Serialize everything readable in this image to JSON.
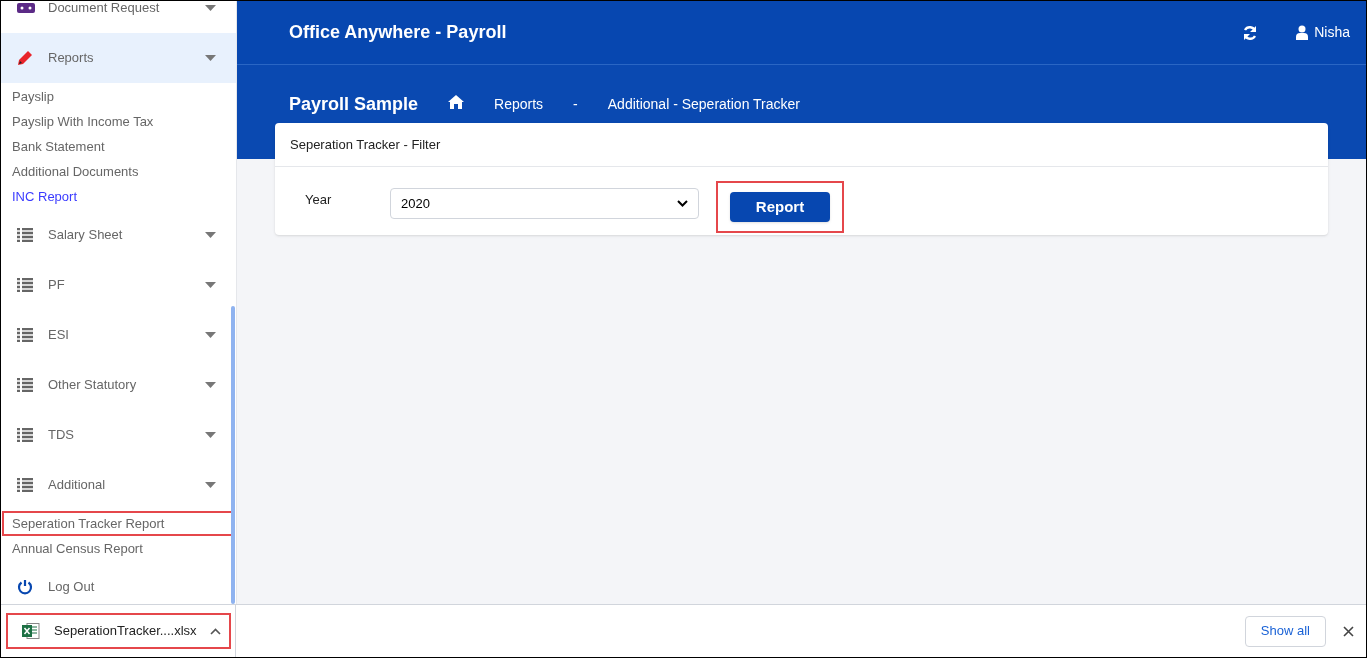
{
  "sidebar": {
    "items": [
      {
        "label": "Document Request",
        "kind": "group",
        "selected": false
      },
      {
        "label": "Reports",
        "kind": "group",
        "selected": true,
        "children": [
          {
            "label": "Payslip",
            "selected": false,
            "highlighted": false
          },
          {
            "label": "Payslip With Income Tax",
            "selected": false,
            "highlighted": false
          },
          {
            "label": "Bank Statement",
            "selected": false,
            "highlighted": false
          },
          {
            "label": "Additional Documents",
            "selected": false,
            "highlighted": false
          },
          {
            "label": "INC Report",
            "selected": true,
            "highlighted": false
          }
        ]
      },
      {
        "label": "Salary Sheet",
        "kind": "group",
        "selected": false
      },
      {
        "label": "PF",
        "kind": "group",
        "selected": false
      },
      {
        "label": "ESI",
        "kind": "group",
        "selected": false
      },
      {
        "label": "Other Statutory",
        "kind": "group",
        "selected": false
      },
      {
        "label": "TDS",
        "kind": "group",
        "selected": false
      },
      {
        "label": "Additional",
        "kind": "group",
        "selected": false,
        "children": [
          {
            "label": "Seperation Tracker Report",
            "selected": false,
            "highlighted": true
          },
          {
            "label": "Annual Census Report",
            "selected": false,
            "highlighted": false
          }
        ]
      },
      {
        "label": "Log Out",
        "kind": "action",
        "selected": false
      }
    ]
  },
  "header": {
    "title": "Office Anywhere - Payroll",
    "user": "Nisha"
  },
  "breadcrumb": {
    "company": "Payroll Sample",
    "items": [
      "Reports",
      "-",
      "Additional - Seperation Tracker"
    ]
  },
  "filter_card": {
    "title": "Seperation Tracker - Filter",
    "field_label": "Year",
    "value": "2020",
    "button": "Report",
    "button_highlighted": true
  },
  "download_bar": {
    "file": "SeperationTracker....xlsx",
    "file_highlighted": true,
    "show_all": "Show all"
  }
}
